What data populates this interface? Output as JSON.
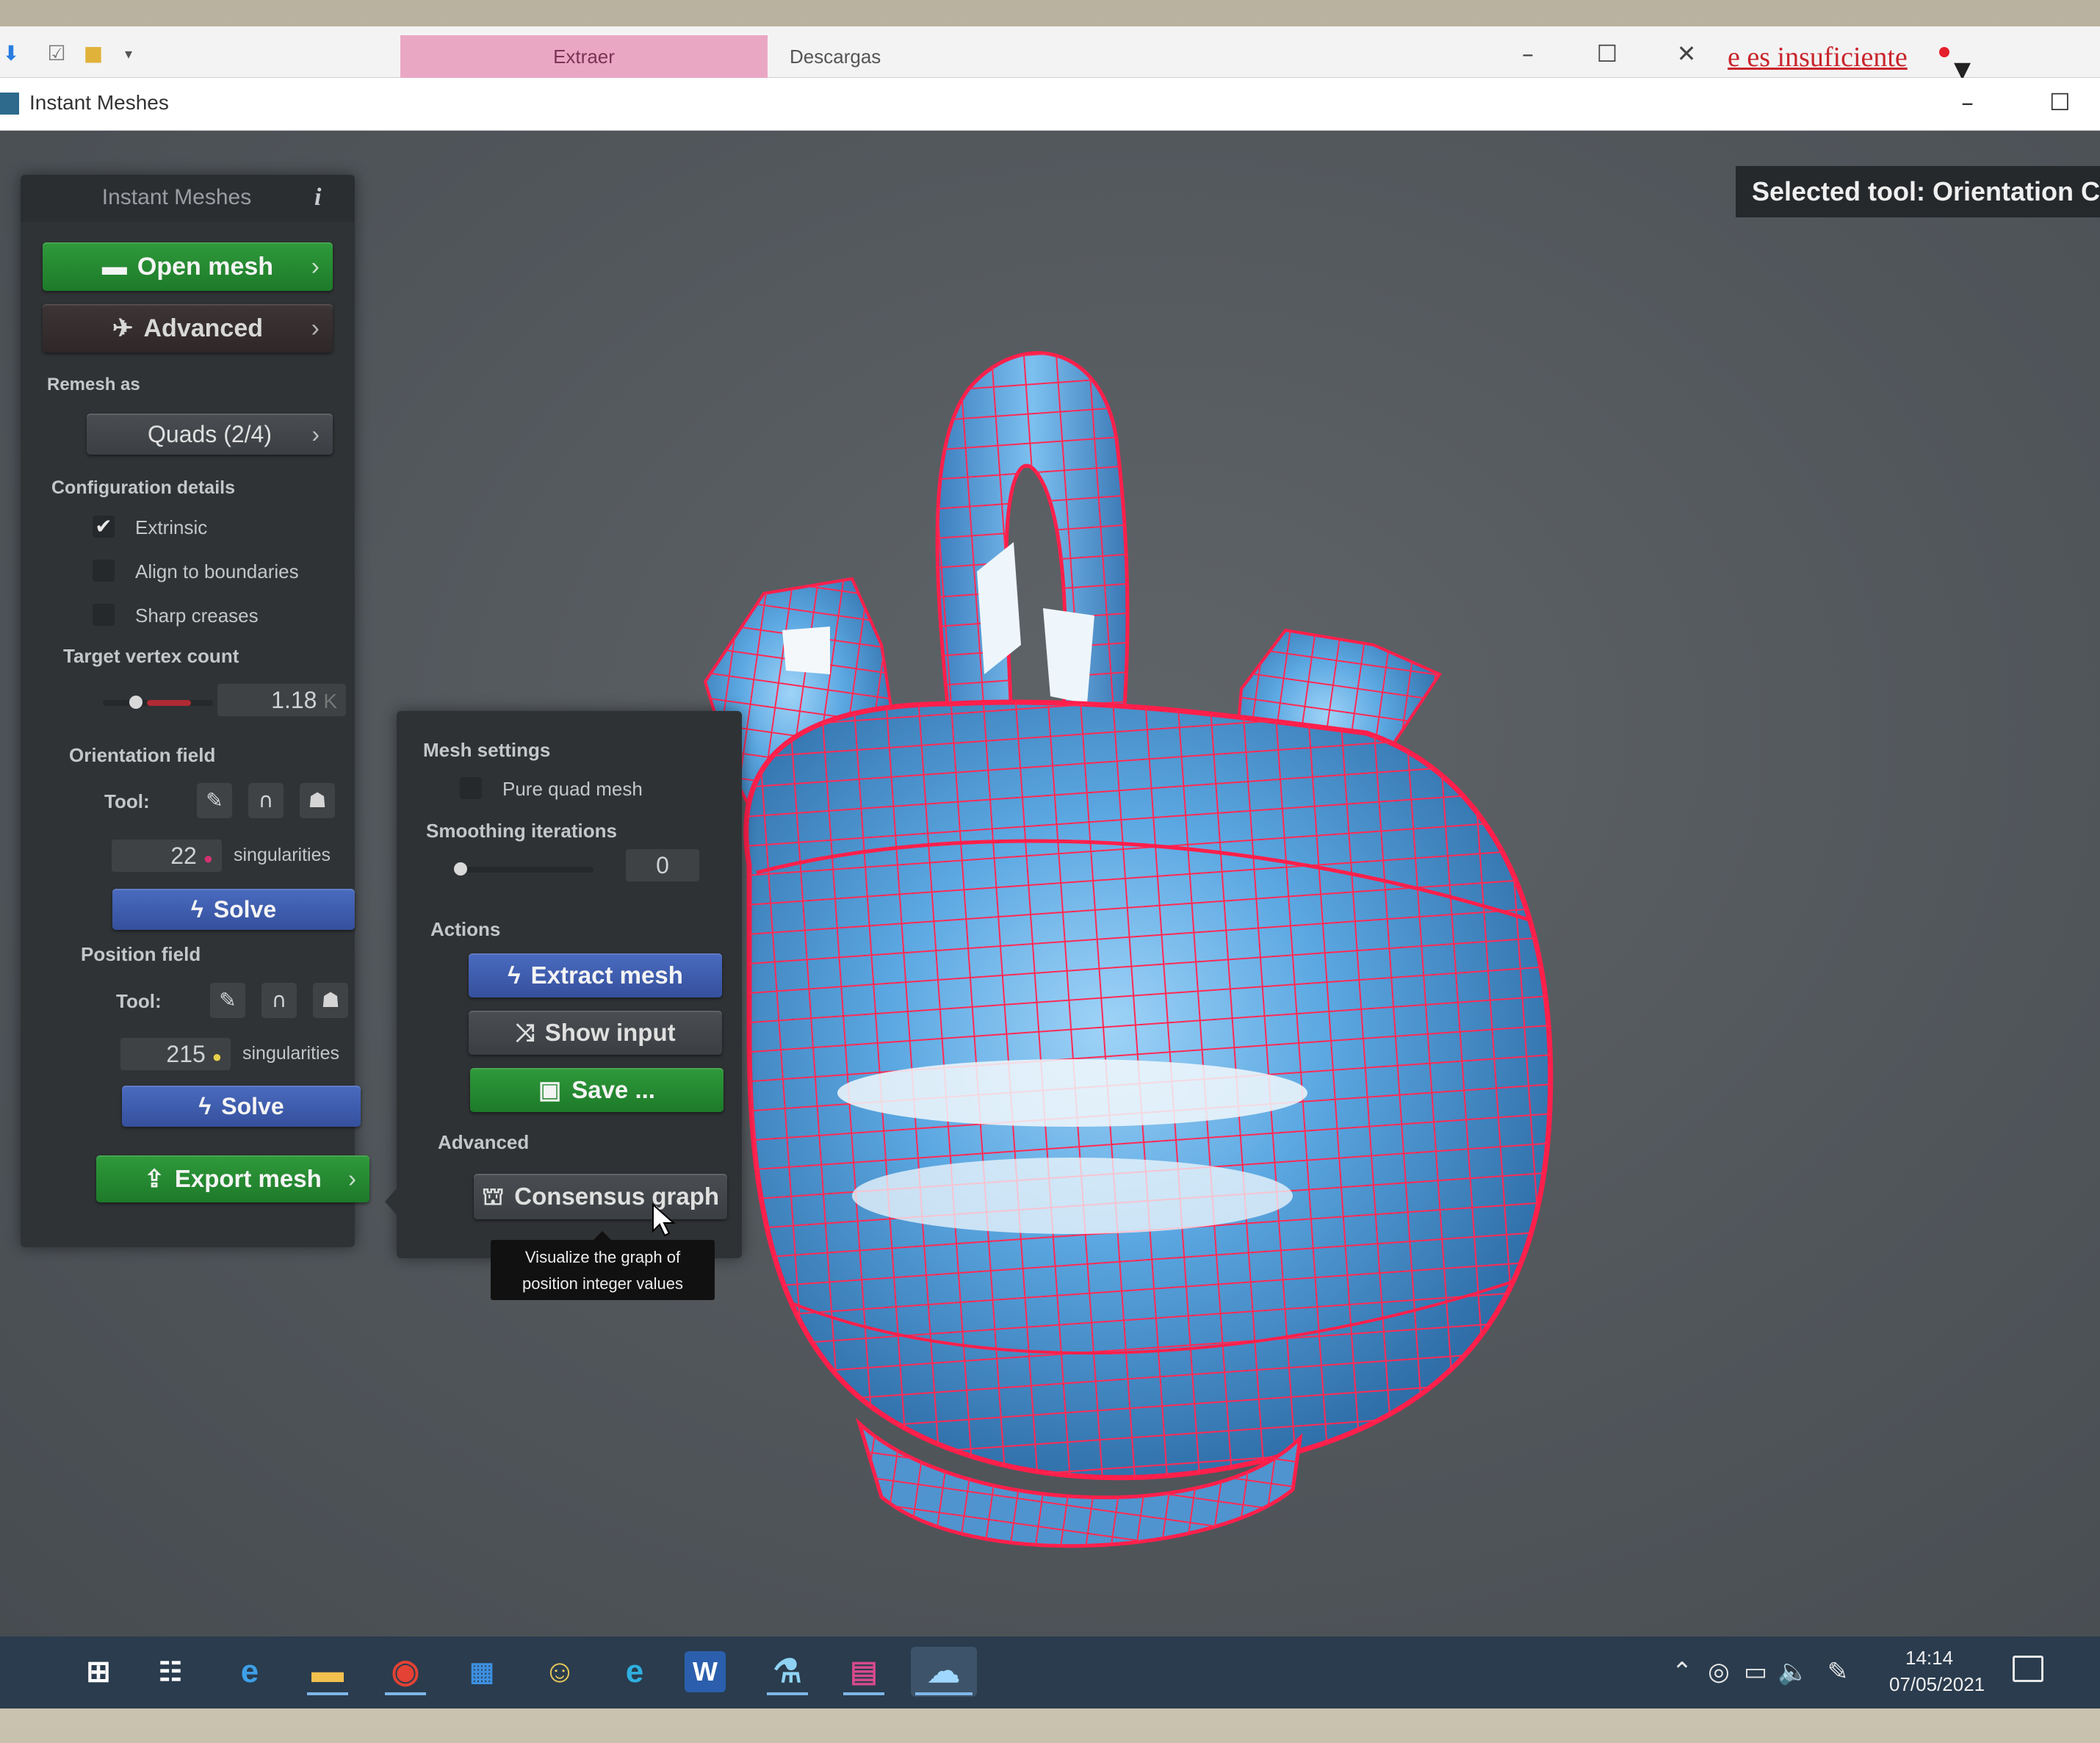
{
  "explorer": {
    "tabs": [
      "Extraer",
      "Descargas"
    ],
    "notice_text": "e es insuficiente",
    "win_controls": [
      "–",
      "☐",
      "✕"
    ]
  },
  "app": {
    "title": "Instant Meshes",
    "win_controls": [
      "–",
      "☐"
    ]
  },
  "viewport": {
    "selected_tool": "Selected tool: Orientation C"
  },
  "main_panel": {
    "title": "Instant Meshes",
    "info_icon": "i",
    "open_mesh": "Open mesh",
    "advanced": "Advanced",
    "remesh_as_label": "Remesh as",
    "remesh_as_value": "Quads (2/4)",
    "config_label": "Configuration details",
    "options": [
      {
        "label": "Extrinsic",
        "checked": true
      },
      {
        "label": "Align to boundaries",
        "checked": false
      },
      {
        "label": "Sharp creases",
        "checked": false
      }
    ],
    "target_vertex_label": "Target vertex count",
    "target_vertex_value": "1.18",
    "target_vertex_unit": "K",
    "orientation_label": "Orientation field",
    "orientation_tool_label": "Tool:",
    "orientation_singularities": "22",
    "singularities_label": "singularities",
    "solve": "Solve",
    "position_label": "Position field",
    "position_tool_label": "Tool:",
    "position_singularities": "215",
    "export_mesh": "Export mesh"
  },
  "mesh_panel": {
    "mesh_settings_label": "Mesh settings",
    "pure_quad_label": "Pure quad mesh",
    "pure_quad_checked": false,
    "smoothing_label": "Smoothing iterations",
    "smoothing_value": "0",
    "actions_label": "Actions",
    "extract_mesh": "Extract mesh",
    "show_input": "Show input",
    "save": "Save ...",
    "advanced_label": "Advanced",
    "consensus_graph": "Consensus graph",
    "tooltip_line1": "Visualize the graph of",
    "tooltip_line2": "position integer values"
  },
  "taskbar": {
    "time": "14:14",
    "date": "07/05/2021"
  },
  "colors": {
    "panel_bg": "#303336",
    "green_button": "#268a33",
    "blue_button": "#3f5daf",
    "mesh_face": "#5aa9e6",
    "mesh_edge": "#ff1f4b",
    "taskbar": "#2a3c4e"
  }
}
